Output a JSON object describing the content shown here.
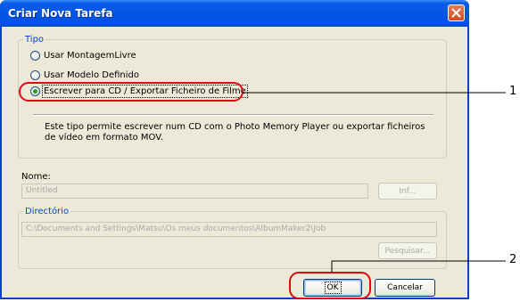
{
  "window": {
    "title": "Criar Nova Tarefa",
    "close_icon": "close-icon"
  },
  "tipo": {
    "legend": "Tipo",
    "options": [
      {
        "label": "Usar MontagemLivre",
        "selected": false
      },
      {
        "label": "Usar Modelo Definido",
        "selected": false
      },
      {
        "label": "Escrever para CD / Exportar Ficheiro de Filme",
        "selected": true
      }
    ],
    "description": "Este tipo permite escrever num CD com o Photo Memory Player ou exportar ficheiros de vídeo em formato MOV."
  },
  "nome": {
    "label": "Nome:",
    "value": "Untitled",
    "info_button": "Inf..."
  },
  "directorio": {
    "legend": "Directório",
    "value": "C:\\Documents and Settings\\Matsu\\Os meus documentos\\AlbumMaker2\\Job",
    "browse_button": "Pesquisar..."
  },
  "buttons": {
    "ok": "OK",
    "cancel": "Cancelar"
  },
  "callouts": {
    "one": "1",
    "two": "2",
    "color": "#e30613"
  },
  "colors": {
    "title_bar": "#0454e4",
    "legend_text": "#0046d5",
    "dialog_bg": "#ece9d8",
    "close_button": "#d64a1c"
  }
}
